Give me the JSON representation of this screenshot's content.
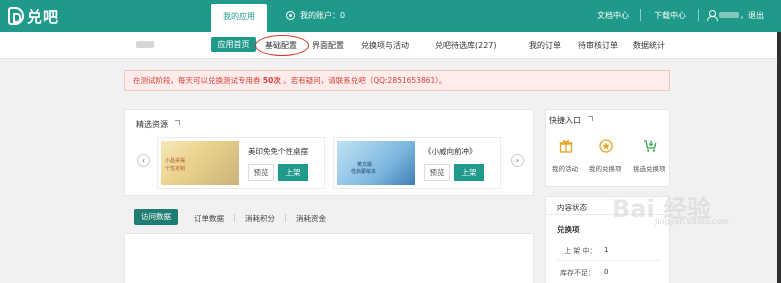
{
  "brand": {
    "logo_text": "兑吧",
    "accent": "#1f9a8a",
    "accent_dark": "#1f7d74",
    "alert_color": "#d6403a"
  },
  "top_nav": {
    "active_tab": "我的应用",
    "account_label": "我的账户：0",
    "docs": "文档中心",
    "downloads": "下载中心",
    "logout": "，退出"
  },
  "sub_nav": {
    "active": "应用首页",
    "items": [
      "基础配置",
      "界面配置",
      "兑换项与活动",
      "兑吧待选库(227)",
      "我的订单",
      "待审核订单",
      "数据统计"
    ]
  },
  "notice": {
    "prefix": "在测试阶段，每天可以兑换测试专用券 ",
    "count": "50次",
    "suffix": " 。若有疑问，请联系兑吧（QQ:2851653861）。"
  },
  "resources": {
    "title": "精选资源",
    "prev_arrow": "‹",
    "next_arrow": "›",
    "cards": [
      {
        "name": "美印免免个性桌摆",
        "thumb_line1": "小昌桌摆",
        "thumb_line2": "个性定制",
        "preview": "预览",
        "shelf": "上架"
      },
      {
        "name": "《小威向前冲》",
        "thumb_line1": "英文版",
        "thumb_line2": "性启蒙绘本",
        "preview": "预览",
        "shelf": "上架"
      }
    ]
  },
  "quick_entry": {
    "title": "快捷入口",
    "items": [
      {
        "label": "我的活动",
        "icon": "gift-icon"
      },
      {
        "label": "我的兑换项",
        "icon": "star-badge-icon"
      },
      {
        "label": "挑选兑换项",
        "icon": "cart-download-icon"
      }
    ]
  },
  "data_tabs": {
    "active": "访问数据",
    "items": [
      "订单数据",
      "消耗积分",
      "消耗资金"
    ]
  },
  "content_status": {
    "title": "内容状态",
    "section": "兑换项",
    "rows": [
      {
        "label": "上 架 中：",
        "value": "1"
      },
      {
        "label": "库存不足：",
        "value": "0"
      }
    ]
  },
  "watermark": {
    "main": "Bai 经验",
    "sub": "jingyan.baidu.com"
  }
}
